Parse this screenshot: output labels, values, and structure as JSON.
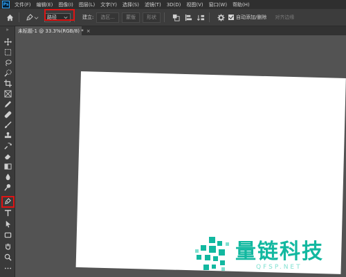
{
  "menubar": {
    "logo": "Ps",
    "items": [
      "文件(F)",
      "编辑(E)",
      "图像(I)",
      "图层(L)",
      "文字(Y)",
      "选择(S)",
      "滤镜(T)",
      "3D(D)",
      "视图(V)",
      "窗口(W)",
      "帮助(H)"
    ]
  },
  "options": {
    "mode_value": "路径",
    "build_label": "建立:",
    "selection_button": "选区...",
    "mask_button": "蒙版",
    "shape_button": "形状",
    "auto_add_delete_label": "自动添加/删除",
    "auto_add_delete_checked": true,
    "align_edges_label": "对齐边缘"
  },
  "tab": {
    "title": "未标题-1 @ 33.3%(RGB/8) *",
    "close": "×"
  },
  "toolbar": {
    "collapse": "»",
    "tools": [
      "move-tool",
      "marquee-tool",
      "lasso-tool",
      "quick-select-tool",
      "crop-tool",
      "frame-tool",
      "eyedropper-tool",
      "healing-brush-tool",
      "brush-tool",
      "clone-stamp-tool",
      "history-brush-tool",
      "eraser-tool",
      "gradient-tool",
      "blur-tool",
      "dodge-tool",
      "pen-tool",
      "type-tool",
      "path-selection-tool",
      "rectangle-tool",
      "hand-tool",
      "zoom-tool",
      "more-tools"
    ],
    "active_tool": "pen-tool"
  },
  "watermark": {
    "title": "量链科技",
    "subtitle": "QFSP.NET",
    "color": "#12b8a0"
  }
}
